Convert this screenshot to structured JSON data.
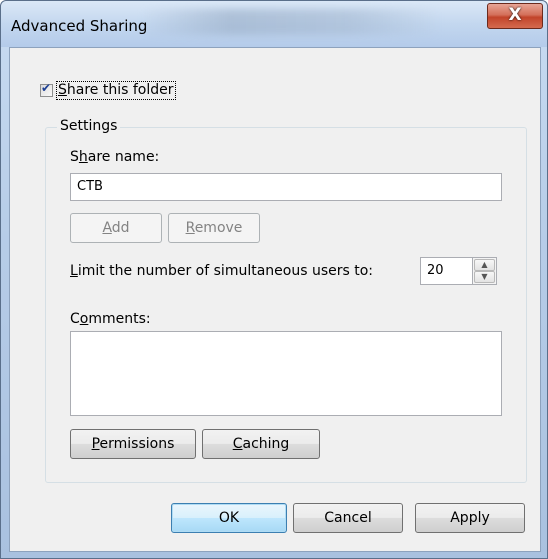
{
  "window": {
    "title": "Advanced Sharing",
    "close_glyph": "X"
  },
  "share_folder": {
    "checked": true,
    "check_glyph": "✔",
    "label_first": "S",
    "label_rest": "hare this folder"
  },
  "settings": {
    "legend": "Settings",
    "share_name_label_before": "S",
    "share_name_label_ul": "h",
    "share_name_label_after": "are name:",
    "share_name_value": "CTB",
    "add_ul": "A",
    "add_rest": "dd",
    "remove_ul": "R",
    "remove_rest": "emove",
    "limit_label_ul": "L",
    "limit_label_rest": "imit the number of simultaneous users to:",
    "limit_value": "20",
    "spin_up_glyph": "▲",
    "spin_down_glyph": "▼",
    "comments_label_first": "C",
    "comments_label_ul": "o",
    "comments_label_rest": "mments:",
    "comments_value": "",
    "permissions_ul": "P",
    "permissions_rest": "ermissions",
    "caching_ul": "C",
    "caching_rest": "aching"
  },
  "footer": {
    "ok_label": "OK",
    "cancel_label": "Cancel",
    "apply_label": "Apply"
  }
}
